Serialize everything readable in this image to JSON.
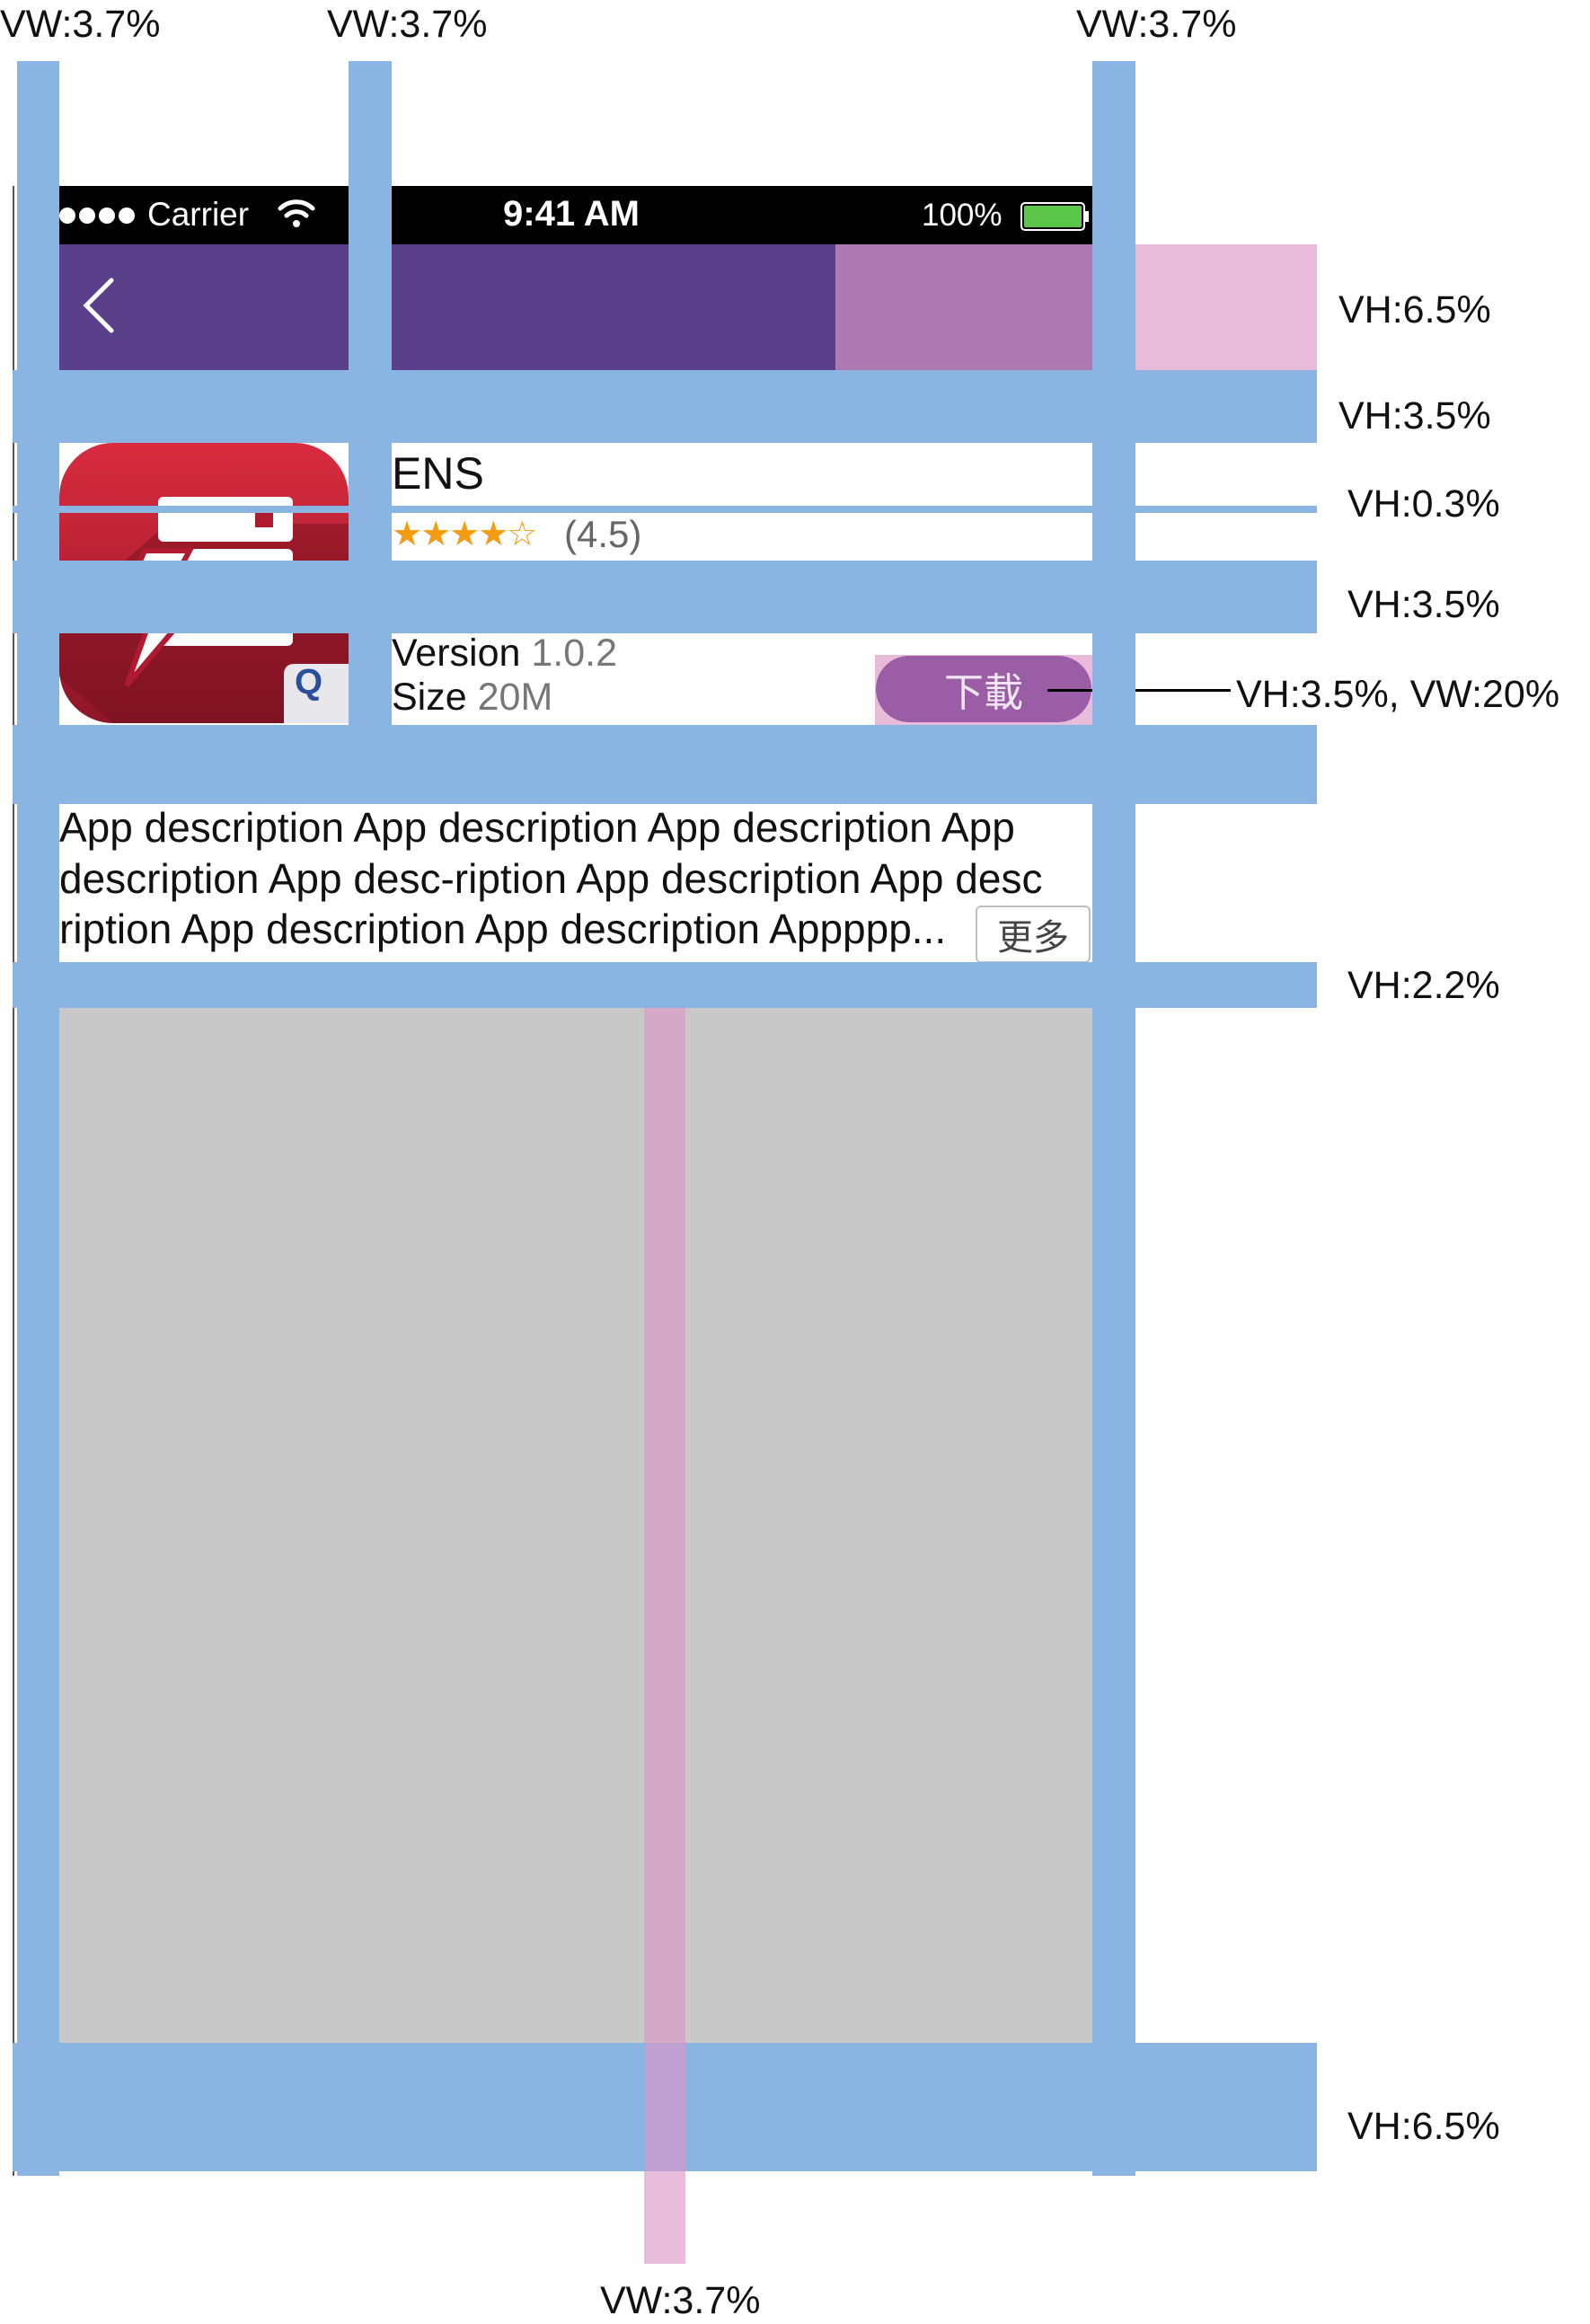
{
  "status_bar": {
    "carrier": "Carrier",
    "time": "9:41 AM",
    "battery": "100%"
  },
  "nav": {
    "back_icon": "chevron-left-icon"
  },
  "app": {
    "name": "ENS",
    "stars": "★★★★☆",
    "rating_text": "(4.5)",
    "rating": 4.5,
    "version_label": "Version",
    "version_value": "1.0.2",
    "size_label": "Size",
    "size_value": "20M",
    "download_label": "下載",
    "description_lines": [
      "App description  App description  App description  App",
      "description App desc-ription App description App desc",
      "ription App description App description Appppp..."
    ],
    "more_label": "更多",
    "icon_badge": "Q"
  },
  "annotations": {
    "vw_top_1": "VW:3.7%",
    "vw_top_2": "VW:3.7%",
    "vw_top_3": "VW:3.7%",
    "vw_bottom": "VW:3.7%",
    "vh_nav": "VH:6.5%",
    "vh_gap1": "VH:3.5%",
    "vh_line": "VH:0.3%",
    "vh_gap2": "VH:3.5%",
    "vh_button": "VH:3.5%, VW:20%",
    "vh_desc_gap": "VH:2.2%",
    "vh_bottom": "VH:6.5%"
  },
  "colors": {
    "guide_blue": "#8ab4e2",
    "guide_pink": "#e0a8d0",
    "nav_purple": "#5a3f8a",
    "download_purple": "#9b5ea6",
    "star_orange": "#f39c12",
    "battery_green": "#5cc64a",
    "icon_red": "#c8213b"
  }
}
